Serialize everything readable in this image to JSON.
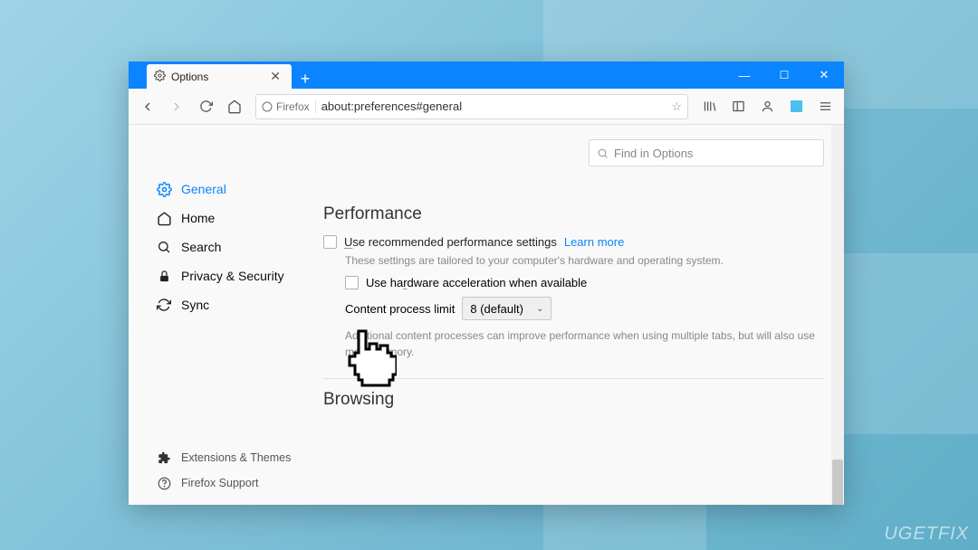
{
  "tab": {
    "title": "Options"
  },
  "address": {
    "context": "Firefox",
    "url": "about:preferences#general"
  },
  "toolbar_icons": {
    "library": "|||\\",
    "sidebar": "◫",
    "account": "◯"
  },
  "search": {
    "placeholder": "Find in Options"
  },
  "nav": {
    "general": "General",
    "home": "Home",
    "search": "Search",
    "privacy": "Privacy & Security",
    "sync": "Sync",
    "extensions": "Extensions & Themes",
    "support": "Firefox Support"
  },
  "perf": {
    "heading": "Performance",
    "use_recommended_pre": "U",
    "use_recommended_post": "se recommended performance settings",
    "learn_more": "Learn more",
    "tailored": "These settings are tailored to your computer's hardware and operating system.",
    "hw_pre": "Use ha",
    "hw_u": "r",
    "hw_post": "dware acceleration when available",
    "limit_label": "Content process limit",
    "limit_value": "8 (default)",
    "desc_line1": "Additional content processes can improve performance when using multiple tabs, but will also use",
    "desc_line2": "more memory."
  },
  "browsing": {
    "heading": "Browsing"
  },
  "watermark": "UGETFIX"
}
